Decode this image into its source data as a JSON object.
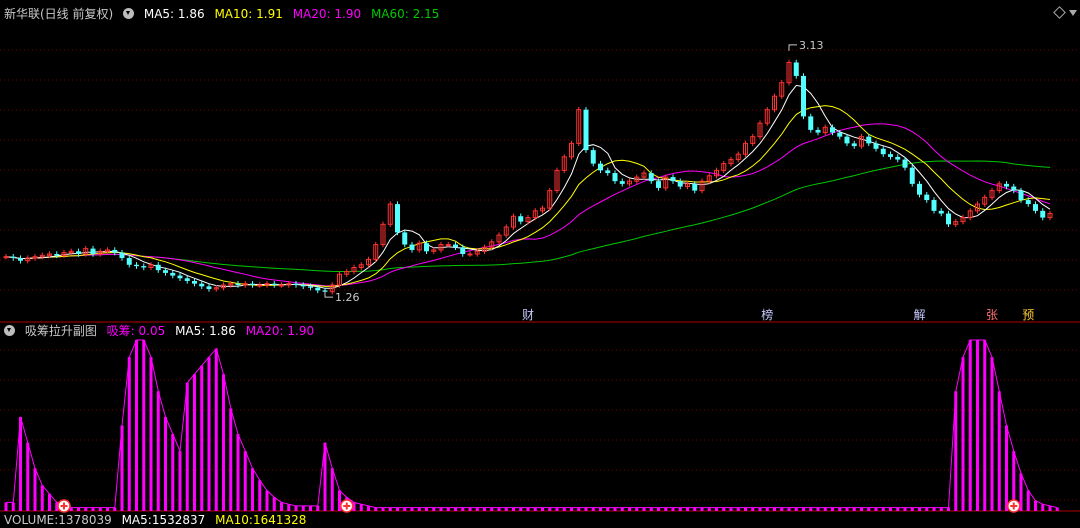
{
  "main_legend": {
    "stock": "新华联(日线 前复权)",
    "ma5": "MA5: 1.86",
    "ma10": "MA10: 1.91",
    "ma20": "MA20: 1.90",
    "ma60": "MA60: 2.15"
  },
  "sub_legend": {
    "title": "吸筹拉升副图",
    "xichou": "吸筹: 0.05",
    "ma5": "MA5: 1.86",
    "ma20": "MA20: 1.90"
  },
  "bottom_legend": {
    "volume": "VOLUME:1378039",
    "ma5": "MA5:1532837",
    "ma10": "MA10:1641328"
  },
  "colors": {
    "up": "#ff3232",
    "down": "#54ffff",
    "ma5": "#ffffff",
    "ma10": "#ffff00",
    "ma20": "#ff00ff",
    "ma60": "#00c800",
    "grid": "#7a0000",
    "xichou": "#ff00ff"
  },
  "chart_data": {
    "type": "candlestick",
    "main_ylim": [
      1.15,
      3.3
    ],
    "sub_ylim": [
      0,
      1
    ],
    "high_annotation": {
      "index": 108,
      "value": 3.13,
      "label": "3.13"
    },
    "low_annotation": {
      "index": 44,
      "value": 1.26,
      "label": "1.26"
    },
    "event_markers": [
      {
        "index": 72,
        "label": "财"
      },
      {
        "index": 105,
        "label": "榜"
      },
      {
        "index": 126,
        "label": "解"
      },
      {
        "index": 136,
        "label": "张"
      },
      {
        "index": 141,
        "label": "预"
      }
    ],
    "signal_markers": [
      {
        "index": 8
      },
      {
        "index": 47
      },
      {
        "index": 139
      }
    ],
    "close": [
      1.56,
      1.55,
      1.53,
      1.55,
      1.56,
      1.57,
      1.58,
      1.57,
      1.59,
      1.6,
      1.58,
      1.62,
      1.58,
      1.6,
      1.61,
      1.59,
      1.55,
      1.5,
      1.49,
      1.48,
      1.5,
      1.46,
      1.44,
      1.42,
      1.4,
      1.38,
      1.36,
      1.34,
      1.32,
      1.33,
      1.35,
      1.36,
      1.35,
      1.36,
      1.35,
      1.35,
      1.36,
      1.35,
      1.35,
      1.36,
      1.35,
      1.34,
      1.33,
      1.31,
      1.3,
      1.35,
      1.43,
      1.45,
      1.48,
      1.5,
      1.54,
      1.65,
      1.8,
      1.95,
      1.74,
      1.65,
      1.61,
      1.66,
      1.6,
      1.61,
      1.65,
      1.65,
      1.63,
      1.58,
      1.58,
      1.6,
      1.63,
      1.67,
      1.72,
      1.78,
      1.86,
      1.82,
      1.85,
      1.9,
      1.92,
      2.05,
      2.2,
      2.3,
      2.4,
      2.65,
      2.35,
      2.25,
      2.2,
      2.18,
      2.12,
      2.1,
      2.12,
      2.15,
      2.18,
      2.12,
      2.07,
      2.15,
      2.12,
      2.08,
      2.1,
      2.05,
      2.12,
      2.16,
      2.2,
      2.25,
      2.28,
      2.32,
      2.4,
      2.45,
      2.55,
      2.65,
      2.75,
      2.85,
      3.0,
      2.9,
      2.6,
      2.5,
      2.48,
      2.52,
      2.48,
      2.45,
      2.4,
      2.38,
      2.45,
      2.4,
      2.36,
      2.32,
      2.3,
      2.28,
      2.22,
      2.1,
      2.02,
      1.98,
      1.9,
      1.88,
      1.8,
      1.82,
      1.85,
      1.9,
      1.95,
      2.0,
      2.05,
      2.1,
      2.08,
      2.05,
      1.98,
      1.95,
      1.9,
      1.85,
      1.88
    ],
    "open": [
      1.56,
      1.56,
      1.55,
      1.53,
      1.55,
      1.56,
      1.57,
      1.58,
      1.57,
      1.59,
      1.6,
      1.58,
      1.62,
      1.58,
      1.6,
      1.61,
      1.59,
      1.55,
      1.5,
      1.49,
      1.48,
      1.5,
      1.46,
      1.44,
      1.42,
      1.4,
      1.38,
      1.36,
      1.34,
      1.32,
      1.33,
      1.35,
      1.36,
      1.35,
      1.36,
      1.35,
      1.35,
      1.36,
      1.35,
      1.35,
      1.36,
      1.35,
      1.34,
      1.33,
      1.31,
      1.3,
      1.35,
      1.43,
      1.45,
      1.48,
      1.5,
      1.54,
      1.65,
      1.8,
      1.95,
      1.74,
      1.65,
      1.61,
      1.66,
      1.6,
      1.61,
      1.65,
      1.65,
      1.63,
      1.58,
      1.58,
      1.6,
      1.63,
      1.67,
      1.72,
      1.78,
      1.86,
      1.82,
      1.85,
      1.9,
      1.92,
      2.05,
      2.2,
      2.3,
      2.4,
      2.65,
      2.35,
      2.25,
      2.2,
      2.18,
      2.12,
      2.1,
      2.12,
      2.15,
      2.18,
      2.12,
      2.07,
      2.15,
      2.12,
      2.08,
      2.1,
      2.05,
      2.12,
      2.16,
      2.2,
      2.25,
      2.28,
      2.32,
      2.4,
      2.45,
      2.55,
      2.65,
      2.75,
      2.85,
      3.0,
      2.9,
      2.6,
      2.5,
      2.48,
      2.52,
      2.48,
      2.45,
      2.4,
      2.38,
      2.45,
      2.4,
      2.36,
      2.32,
      2.3,
      2.28,
      2.22,
      2.1,
      2.02,
      1.98,
      1.9,
      1.88,
      1.8,
      1.82,
      1.85,
      1.9,
      1.95,
      2.0,
      2.05,
      2.1,
      2.08,
      2.05,
      1.98,
      1.95,
      1.9,
      1.85
    ],
    "xichou": [
      0.05,
      0.05,
      0.55,
      0.4,
      0.25,
      0.15,
      0.1,
      0.05,
      0.05,
      0.02,
      0.02,
      0.02,
      0.02,
      0.02,
      0.02,
      0.02,
      0.5,
      0.9,
      1.0,
      1.0,
      0.9,
      0.7,
      0.55,
      0.45,
      0.35,
      0.75,
      0.8,
      0.85,
      0.9,
      0.95,
      0.8,
      0.6,
      0.45,
      0.35,
      0.25,
      0.18,
      0.12,
      0.08,
      0.05,
      0.04,
      0.03,
      0.03,
      0.03,
      0.03,
      0.4,
      0.25,
      0.12,
      0.08,
      0.05,
      0.04,
      0.03,
      0.02,
      0.02,
      0.02,
      0.02,
      0.02,
      0.02,
      0.02,
      0.02,
      0.02,
      0.02,
      0.02,
      0.02,
      0.02,
      0.02,
      0.02,
      0.02,
      0.02,
      0.02,
      0.02,
      0.02,
      0.02,
      0.02,
      0.02,
      0.02,
      0.02,
      0.02,
      0.02,
      0.02,
      0.02,
      0.02,
      0.02,
      0.02,
      0.02,
      0.02,
      0.02,
      0.02,
      0.02,
      0.02,
      0.02,
      0.02,
      0.02,
      0.02,
      0.02,
      0.02,
      0.02,
      0.02,
      0.02,
      0.02,
      0.02,
      0.02,
      0.02,
      0.02,
      0.02,
      0.02,
      0.02,
      0.02,
      0.02,
      0.02,
      0.02,
      0.02,
      0.02,
      0.02,
      0.02,
      0.02,
      0.02,
      0.02,
      0.02,
      0.02,
      0.02,
      0.02,
      0.02,
      0.02,
      0.02,
      0.02,
      0.02,
      0.02,
      0.02,
      0.02,
      0.02,
      0.02,
      0.7,
      0.9,
      1.0,
      1.0,
      1.0,
      0.9,
      0.7,
      0.5,
      0.35,
      0.22,
      0.12,
      0.06,
      0.04,
      0.03,
      0.02
    ]
  }
}
